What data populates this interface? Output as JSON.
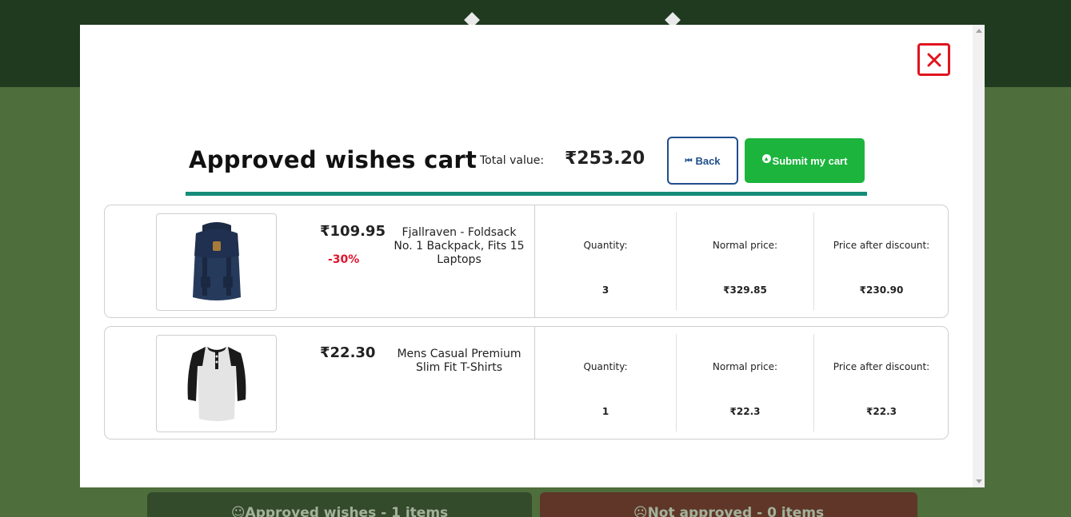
{
  "background": {
    "tabs": [
      {
        "label": "☺Approved wishes - 1 items"
      },
      {
        "label": "☹Not approved - 0 items"
      }
    ]
  },
  "modal": {
    "title": "Approved wishes cart",
    "total_label": "Total value:",
    "total_value": "₹253.20",
    "back_label": "Back",
    "submit_label": "Submit my cart",
    "close_icon": "close-icon",
    "colors": {
      "accent_underline": "#148c78",
      "submit_bg": "#1cb43c",
      "back_border": "#1f4e8c",
      "close_border": "#e0141e",
      "discount": "#e0142c"
    },
    "items": [
      {
        "price": "₹109.95",
        "discount": "-30%",
        "name": "Fjallraven - Foldsack No. 1 Backpack, Fits 15 Laptops",
        "image_icon": "backpack-image",
        "quantity_label": "Quantity:",
        "quantity": "3",
        "normal_price_label": "Normal price:",
        "normal_price": "₹329.85",
        "discount_price_label": "Price after discount:",
        "discount_price": "₹230.90"
      },
      {
        "price": "₹22.30",
        "discount": "",
        "name": "Mens Casual Premium Slim Fit T-Shirts",
        "image_icon": "tshirt-image",
        "quantity_label": "Quantity:",
        "quantity": "1",
        "normal_price_label": "Normal price:",
        "normal_price": "₹22.3",
        "discount_price_label": "Price after discount:",
        "discount_price": "₹22.3"
      }
    ]
  }
}
